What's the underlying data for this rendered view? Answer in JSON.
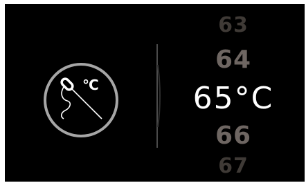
{
  "probe": {
    "icon": "meat-probe-icon",
    "unit": "°C"
  },
  "temperature_picker": {
    "above_2": "63",
    "above_1": "64",
    "selected": "65°C",
    "below_1": "66",
    "below_2": "67"
  },
  "colors": {
    "background": "#000000",
    "selected_text": "#ffffff",
    "near_text": "#6e6662",
    "far_text": "#3f3a36",
    "ring": "#a6a6a6"
  }
}
